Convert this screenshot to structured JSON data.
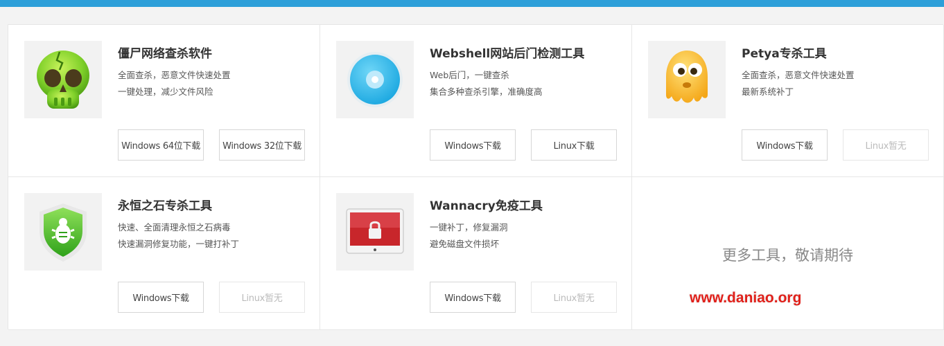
{
  "tools": [
    {
      "title": "僵尸网络查杀软件",
      "desc1": "全面查杀，恶意文件快速处置",
      "desc2": "一键处理，减少文件风险",
      "icon": "green-skull-icon",
      "btn1": "Windows 64位下载",
      "btn2": "Windows 32位下载"
    },
    {
      "title": "Webshell网站后门检测工具",
      "desc1": "Web后门，一键查杀",
      "desc2": "集合多种查杀引擎，准确度高",
      "icon": "blue-disc-icon",
      "btn1": "Windows下载",
      "btn2": "Linux下载"
    },
    {
      "title": "Petya专杀工具",
      "desc1": "全面查杀，恶意文件快速处置",
      "desc2": "最新系统补丁",
      "icon": "yellow-ghost-icon",
      "btn1": "Windows下载",
      "btn2": "Linux暂无"
    },
    {
      "title": "永恒之石专杀工具",
      "desc1": "快速、全面清理永恒之石病毒",
      "desc2": "快速漏洞修复功能，一键打补丁",
      "icon": "green-shield-bug-icon",
      "btn1": "Windows下载",
      "btn2": "Linux暂无"
    },
    {
      "title": "Wannacry免疫工具",
      "desc1": "一键补丁，修复漏洞",
      "desc2": "避免磁盘文件损坏",
      "icon": "red-lock-screen-icon",
      "btn1": "Windows下载",
      "btn2": "Linux暂无"
    }
  ],
  "more_text": "更多工具，敬请期待",
  "watermark": "www.daniao.org",
  "colors": {
    "topbar": "#2d9fd9",
    "border": "#e6e6e6",
    "watermark": "#e0201a"
  }
}
